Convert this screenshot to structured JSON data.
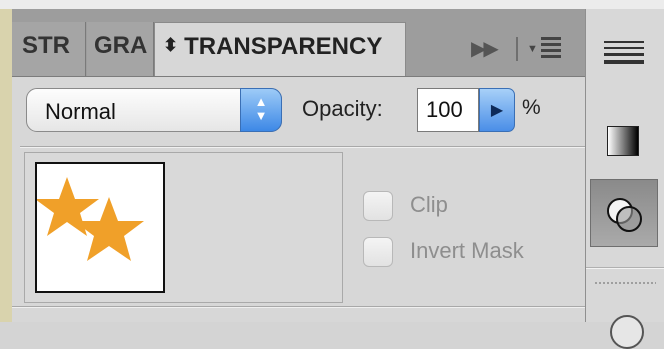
{
  "tabs": [
    {
      "label": "STR",
      "active": false
    },
    {
      "label": "GRA",
      "active": false
    },
    {
      "label": "TRANSPARENCY",
      "active": true
    }
  ],
  "panel_menu": {
    "expand_icon": "double-chevron-right-icon",
    "menu_icon": "panel-menu-icon"
  },
  "blend_mode": {
    "value": "Normal"
  },
  "opacity": {
    "label": "Opacity:",
    "value": "100",
    "unit": "%"
  },
  "thumbnail": {
    "icon": "star-artwork-thumbnail",
    "color": "#f0a029"
  },
  "checkboxes": [
    {
      "label": "Clip",
      "checked": false
    },
    {
      "label": "Invert Mask",
      "checked": false
    }
  ],
  "side_toolbar": [
    {
      "icon": "stroke-lines-icon",
      "active": false
    },
    {
      "icon": "gradient-icon",
      "active": false
    },
    {
      "icon": "transparency-icon",
      "active": true
    },
    {
      "icon": "appearance-icon",
      "active": false
    }
  ]
}
